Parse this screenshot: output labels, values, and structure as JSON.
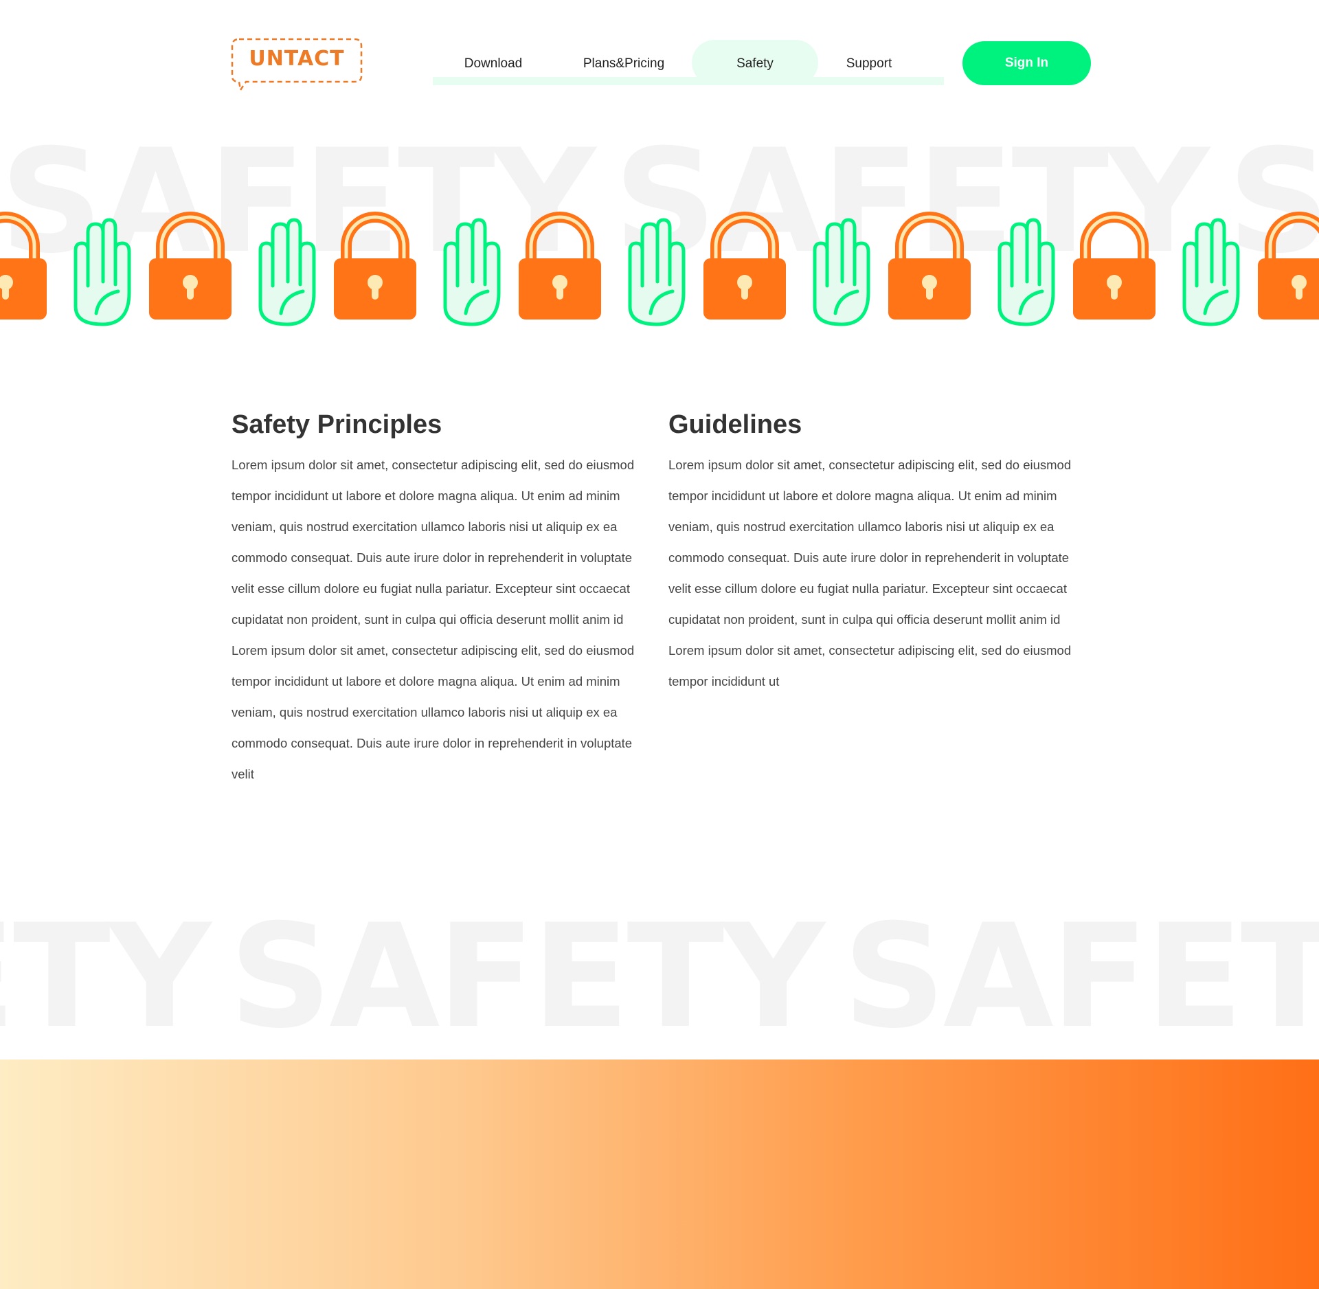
{
  "logo": {
    "text": "UNTACT"
  },
  "nav": {
    "items": [
      "Download",
      "Plans&Pricing",
      "Safety",
      "Support"
    ],
    "active": "Safety"
  },
  "header": {
    "signin_label": "Sign In"
  },
  "banner": {
    "word": "SAFETY"
  },
  "icons": [
    "lock-icon",
    "hand-icon"
  ],
  "colors": {
    "accent_green": "#00f27e",
    "accent_orange": "#ff7417",
    "nav_highlight": "#e8fdf1",
    "watermark": "#f3f3f3"
  },
  "sections": {
    "principles": {
      "title": "Safety Principles",
      "body": "Lorem ipsum dolor sit amet, consectetur adipiscing elit, sed do eiusmod tempor incididunt ut labore et dolore magna aliqua. Ut enim ad minim veniam, quis nostrud exercitation ullamco laboris nisi ut aliquip ex ea commodo consequat. Duis aute irure dolor in reprehenderit in voluptate velit esse cillum dolore eu fugiat nulla pariatur. Excepteur sint occaecat cupidatat non proident, sunt in culpa qui officia deserunt mollit anim id Lorem ipsum dolor sit amet, consectetur adipiscing elit, sed do eiusmod tempor incididunt ut labore et dolore magna aliqua. Ut enim ad minim veniam, quis nostrud exercitation ullamco laboris nisi ut aliquip ex ea commodo consequat. Duis aute irure dolor in reprehenderit in voluptate velit"
    },
    "guidelines": {
      "title": "Guidelines",
      "body": "Lorem ipsum dolor sit amet, consectetur adipiscing elit, sed do eiusmod tempor incididunt ut labore et dolore magna aliqua. Ut enim ad minim veniam, quis nostrud exercitation ullamco laboris nisi ut aliquip ex ea commodo consequat. Duis aute irure dolor in reprehenderit in voluptate velit esse cillum dolore eu fugiat nulla pariatur. Excepteur sint occaecat cupidatat non proident, sunt in culpa qui officia deserunt mollit anim id Lorem ipsum dolor sit amet, consectetur adipiscing elit, sed do eiusmod tempor incididunt ut"
    }
  }
}
